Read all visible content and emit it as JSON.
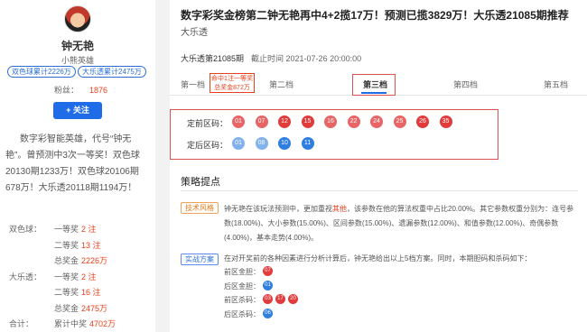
{
  "author": {
    "name": "钟无艳",
    "subtitle": "小熊英雄",
    "badges": [
      "双色球累计2226万",
      "大乐透累计2475万"
    ],
    "fans_label": "粉丝：",
    "fans_value": "1876",
    "follow_label": "+ 关注",
    "bio": "数字彩智能英雄，代号“钟无艳”。曾预测中3次一等奖！双色球20130期1233万！双色球20106期678万！大乐透20118期1194万！"
  },
  "stats": [
    {
      "category": "双色球：",
      "label": "一等奖",
      "value": "2 注"
    },
    {
      "category": "",
      "label": "二等奖",
      "value": "13 注"
    },
    {
      "category": "",
      "label": "总奖金",
      "value": "2226万"
    },
    {
      "category": "大乐透：",
      "label": "一等奖",
      "value": "2 注"
    },
    {
      "category": "",
      "label": "二等奖",
      "value": "16 注"
    },
    {
      "category": "",
      "label": "总奖金",
      "value": "2475万"
    },
    {
      "category": "合计：",
      "label": "累计中奖",
      "value": "4702万"
    }
  ],
  "article": {
    "title": "数字彩奖金榜第二钟无艳再中4+2揽17万！预测已揽3829万！大乐透21085期推荐",
    "subtitle": "大乐透",
    "issue": "大乐透第21085期",
    "deadline": "截止时间 2021-07-26 20:00:00"
  },
  "tabs": [
    "第一档",
    "第二档",
    "第三档",
    "第四档",
    "第五档"
  ],
  "tip": {
    "line1": "命中1注一等奖",
    "line2": "总奖金872万"
  },
  "front": {
    "label": "定前区码：",
    "numbers": [
      "01",
      "07",
      "12",
      "15",
      "16",
      "22",
      "24",
      "25",
      "26",
      "35"
    ]
  },
  "back": {
    "label": "定后区码：",
    "numbers": [
      "01",
      "08",
      "10",
      "11"
    ]
  },
  "section_title": "策略提点",
  "analysis": {
    "tag": "技术风格",
    "text_before": "钟无艳在该玩法预测中，更加重视",
    "highlight": "其他",
    "text_after": "，该参数在他的算法权重中占比20.00%。其它参数权重分别为：连号参数(18.00%)、大小参数(15.00%)、区间参数(15.00%)、遗漏参数(12.00%)、和值参数(12.00%)、奇偶参数(4.00%)，基本走势(4.00%)。"
  },
  "solution": {
    "tag": "实战方案",
    "text": "在对开奖前的各种因素进行分析计算后，钟无艳给出以上5档方案。同时，本期胆码和杀码如下：",
    "rows": [
      {
        "label": "前区金胆：",
        "balls": [
          "07"
        ],
        "kind": "red"
      },
      {
        "label": "后区金胆：",
        "balls": [
          "01"
        ],
        "kind": "blue"
      },
      {
        "label": "前区杀码：",
        "balls": [
          "03",
          "17",
          "20"
        ],
        "kind": "red"
      },
      {
        "label": "后区杀码：",
        "balls": [
          "06"
        ],
        "kind": "blue"
      }
    ]
  },
  "colors": {
    "red_ball": "#e23b3b",
    "blue_ball": "#2f7fe0",
    "accent": "#1e6ce8",
    "highlight": "#e8401c"
  }
}
